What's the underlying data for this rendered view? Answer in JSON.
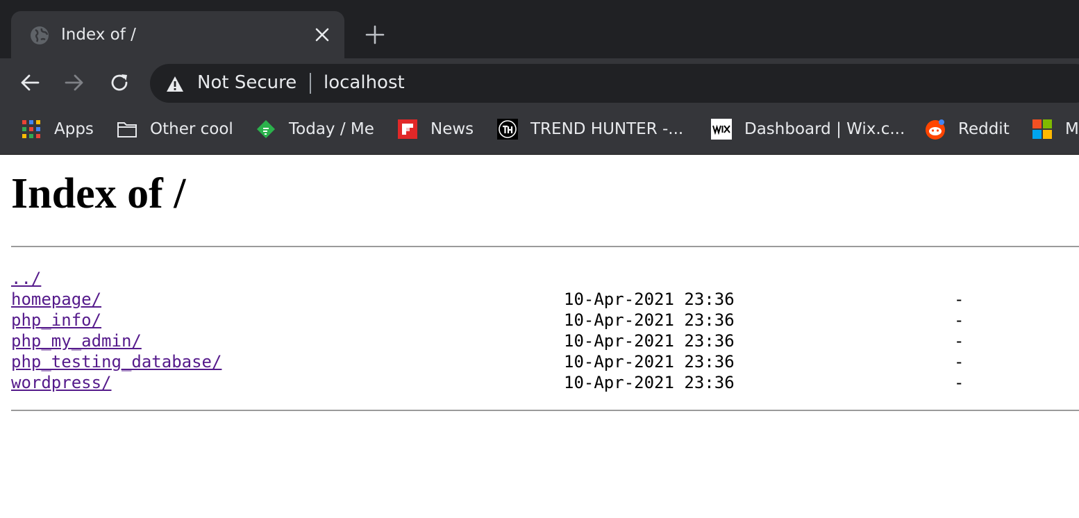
{
  "tab": {
    "title": "Index of /",
    "favicon": "globe-icon"
  },
  "toolbar": {
    "security_label": "Not Secure",
    "url": "localhost"
  },
  "bookmarks": [
    {
      "label": "Apps",
      "icon": "apps-grid-icon"
    },
    {
      "label": "Other cool",
      "icon": "folder-icon"
    },
    {
      "label": "Today / Me",
      "icon": "feedly-icon"
    },
    {
      "label": "News",
      "icon": "flipboard-icon"
    },
    {
      "label": "TREND HUNTER -...",
      "icon": "trendhunter-icon"
    },
    {
      "label": "Dashboard | Wix.c...",
      "icon": "wix-icon"
    },
    {
      "label": "Reddit",
      "icon": "reddit-icon"
    },
    {
      "label": "M",
      "icon": "microsoft-icon"
    }
  ],
  "page": {
    "heading": "Index of /",
    "entries": [
      {
        "name": "../",
        "date": "",
        "size": ""
      },
      {
        "name": "homepage/",
        "date": "10-Apr-2021 23:36",
        "size": "-"
      },
      {
        "name": "php_info/",
        "date": "10-Apr-2021 23:36",
        "size": "-"
      },
      {
        "name": "php_my_admin/",
        "date": "10-Apr-2021 23:36",
        "size": "-"
      },
      {
        "name": "php_testing_database/",
        "date": "10-Apr-2021 23:36",
        "size": "-"
      },
      {
        "name": "wordpress/",
        "date": "10-Apr-2021 23:36",
        "size": "-"
      }
    ]
  },
  "colors": {
    "chrome_dark": "#202124",
    "chrome_toolbar": "#35363a",
    "visited_link": "#551a8b"
  }
}
